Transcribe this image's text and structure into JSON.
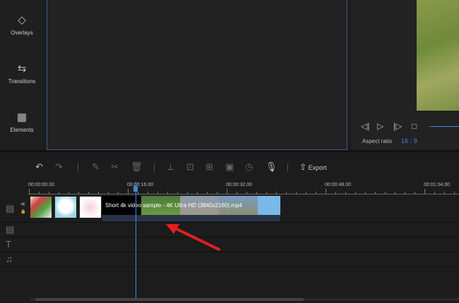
{
  "sidebar": {
    "items": [
      {
        "label": "Overlays",
        "icon": "layers-icon"
      },
      {
        "label": "Transitions",
        "icon": "transitions-icon"
      },
      {
        "label": "Elements",
        "icon": "film-icon"
      }
    ]
  },
  "preview": {
    "aspect_label": "Aspect ratio",
    "aspect_value": "16 : 9"
  },
  "toolbar": {
    "export_label": "Export"
  },
  "ruler": {
    "labels": [
      "00:00:00.00",
      "00:00:16.00",
      "00:00:32.00",
      "00:00:48.00",
      "00:01:04.00"
    ]
  },
  "timeline": {
    "clip_title": "Short 4k video sample - 4K Ultra HD (3840x2160).mp4"
  },
  "colors": {
    "accent": "#3c8ad8",
    "arrow": "#e02020"
  }
}
